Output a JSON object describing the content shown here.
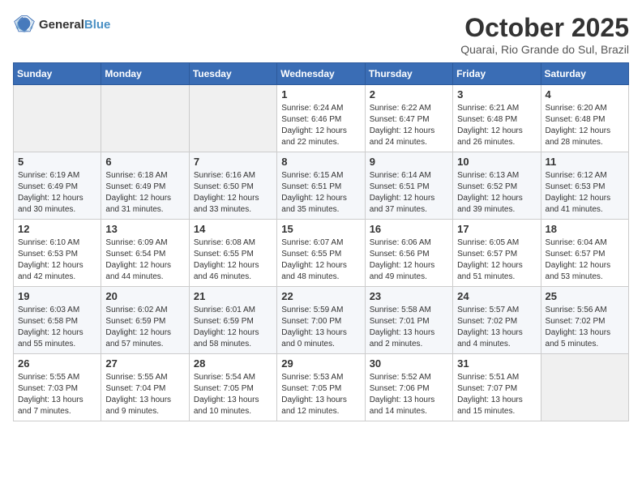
{
  "header": {
    "logo_line1": "General",
    "logo_line2": "Blue",
    "month": "October 2025",
    "location": "Quarai, Rio Grande do Sul, Brazil"
  },
  "weekdays": [
    "Sunday",
    "Monday",
    "Tuesday",
    "Wednesday",
    "Thursday",
    "Friday",
    "Saturday"
  ],
  "weeks": [
    [
      {
        "day": "",
        "empty": true
      },
      {
        "day": "",
        "empty": true
      },
      {
        "day": "",
        "empty": true
      },
      {
        "day": "1",
        "sunrise": "Sunrise: 6:24 AM",
        "sunset": "Sunset: 6:46 PM",
        "daylight": "Daylight: 12 hours and 22 minutes."
      },
      {
        "day": "2",
        "sunrise": "Sunrise: 6:22 AM",
        "sunset": "Sunset: 6:47 PM",
        "daylight": "Daylight: 12 hours and 24 minutes."
      },
      {
        "day": "3",
        "sunrise": "Sunrise: 6:21 AM",
        "sunset": "Sunset: 6:48 PM",
        "daylight": "Daylight: 12 hours and 26 minutes."
      },
      {
        "day": "4",
        "sunrise": "Sunrise: 6:20 AM",
        "sunset": "Sunset: 6:48 PM",
        "daylight": "Daylight: 12 hours and 28 minutes."
      }
    ],
    [
      {
        "day": "5",
        "sunrise": "Sunrise: 6:19 AM",
        "sunset": "Sunset: 6:49 PM",
        "daylight": "Daylight: 12 hours and 30 minutes."
      },
      {
        "day": "6",
        "sunrise": "Sunrise: 6:18 AM",
        "sunset": "Sunset: 6:49 PM",
        "daylight": "Daylight: 12 hours and 31 minutes."
      },
      {
        "day": "7",
        "sunrise": "Sunrise: 6:16 AM",
        "sunset": "Sunset: 6:50 PM",
        "daylight": "Daylight: 12 hours and 33 minutes."
      },
      {
        "day": "8",
        "sunrise": "Sunrise: 6:15 AM",
        "sunset": "Sunset: 6:51 PM",
        "daylight": "Daylight: 12 hours and 35 minutes."
      },
      {
        "day": "9",
        "sunrise": "Sunrise: 6:14 AM",
        "sunset": "Sunset: 6:51 PM",
        "daylight": "Daylight: 12 hours and 37 minutes."
      },
      {
        "day": "10",
        "sunrise": "Sunrise: 6:13 AM",
        "sunset": "Sunset: 6:52 PM",
        "daylight": "Daylight: 12 hours and 39 minutes."
      },
      {
        "day": "11",
        "sunrise": "Sunrise: 6:12 AM",
        "sunset": "Sunset: 6:53 PM",
        "daylight": "Daylight: 12 hours and 41 minutes."
      }
    ],
    [
      {
        "day": "12",
        "sunrise": "Sunrise: 6:10 AM",
        "sunset": "Sunset: 6:53 PM",
        "daylight": "Daylight: 12 hours and 42 minutes."
      },
      {
        "day": "13",
        "sunrise": "Sunrise: 6:09 AM",
        "sunset": "Sunset: 6:54 PM",
        "daylight": "Daylight: 12 hours and 44 minutes."
      },
      {
        "day": "14",
        "sunrise": "Sunrise: 6:08 AM",
        "sunset": "Sunset: 6:55 PM",
        "daylight": "Daylight: 12 hours and 46 minutes."
      },
      {
        "day": "15",
        "sunrise": "Sunrise: 6:07 AM",
        "sunset": "Sunset: 6:55 PM",
        "daylight": "Daylight: 12 hours and 48 minutes."
      },
      {
        "day": "16",
        "sunrise": "Sunrise: 6:06 AM",
        "sunset": "Sunset: 6:56 PM",
        "daylight": "Daylight: 12 hours and 49 minutes."
      },
      {
        "day": "17",
        "sunrise": "Sunrise: 6:05 AM",
        "sunset": "Sunset: 6:57 PM",
        "daylight": "Daylight: 12 hours and 51 minutes."
      },
      {
        "day": "18",
        "sunrise": "Sunrise: 6:04 AM",
        "sunset": "Sunset: 6:57 PM",
        "daylight": "Daylight: 12 hours and 53 minutes."
      }
    ],
    [
      {
        "day": "19",
        "sunrise": "Sunrise: 6:03 AM",
        "sunset": "Sunset: 6:58 PM",
        "daylight": "Daylight: 12 hours and 55 minutes."
      },
      {
        "day": "20",
        "sunrise": "Sunrise: 6:02 AM",
        "sunset": "Sunset: 6:59 PM",
        "daylight": "Daylight: 12 hours and 57 minutes."
      },
      {
        "day": "21",
        "sunrise": "Sunrise: 6:01 AM",
        "sunset": "Sunset: 6:59 PM",
        "daylight": "Daylight: 12 hours and 58 minutes."
      },
      {
        "day": "22",
        "sunrise": "Sunrise: 5:59 AM",
        "sunset": "Sunset: 7:00 PM",
        "daylight": "Daylight: 13 hours and 0 minutes."
      },
      {
        "day": "23",
        "sunrise": "Sunrise: 5:58 AM",
        "sunset": "Sunset: 7:01 PM",
        "daylight": "Daylight: 13 hours and 2 minutes."
      },
      {
        "day": "24",
        "sunrise": "Sunrise: 5:57 AM",
        "sunset": "Sunset: 7:02 PM",
        "daylight": "Daylight: 13 hours and 4 minutes."
      },
      {
        "day": "25",
        "sunrise": "Sunrise: 5:56 AM",
        "sunset": "Sunset: 7:02 PM",
        "daylight": "Daylight: 13 hours and 5 minutes."
      }
    ],
    [
      {
        "day": "26",
        "sunrise": "Sunrise: 5:55 AM",
        "sunset": "Sunset: 7:03 PM",
        "daylight": "Daylight: 13 hours and 7 minutes."
      },
      {
        "day": "27",
        "sunrise": "Sunrise: 5:55 AM",
        "sunset": "Sunset: 7:04 PM",
        "daylight": "Daylight: 13 hours and 9 minutes."
      },
      {
        "day": "28",
        "sunrise": "Sunrise: 5:54 AM",
        "sunset": "Sunset: 7:05 PM",
        "daylight": "Daylight: 13 hours and 10 minutes."
      },
      {
        "day": "29",
        "sunrise": "Sunrise: 5:53 AM",
        "sunset": "Sunset: 7:05 PM",
        "daylight": "Daylight: 13 hours and 12 minutes."
      },
      {
        "day": "30",
        "sunrise": "Sunrise: 5:52 AM",
        "sunset": "Sunset: 7:06 PM",
        "daylight": "Daylight: 13 hours and 14 minutes."
      },
      {
        "day": "31",
        "sunrise": "Sunrise: 5:51 AM",
        "sunset": "Sunset: 7:07 PM",
        "daylight": "Daylight: 13 hours and 15 minutes."
      },
      {
        "day": "",
        "empty": true
      }
    ]
  ]
}
